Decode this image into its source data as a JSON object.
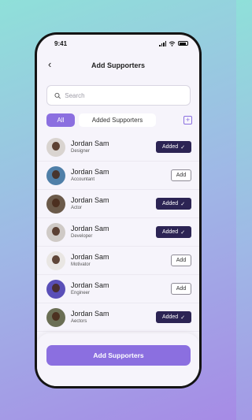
{
  "status_bar": {
    "time": "9:41"
  },
  "header": {
    "title": "Add Supporters"
  },
  "search": {
    "placeholder": "Search"
  },
  "tabs": [
    {
      "label": "All"
    },
    {
      "label": "Added Supporters"
    }
  ],
  "supporters": [
    {
      "name": "Jordan Sam",
      "role": "Designer",
      "status": "Added"
    },
    {
      "name": "Jordan Sam",
      "role": "Accountant",
      "status": "Add"
    },
    {
      "name": "Jordan Sam",
      "role": "Actor",
      "status": "Added"
    },
    {
      "name": "Jordan Sam",
      "role": "Developer",
      "status": "Added"
    },
    {
      "name": "Jordan Sam",
      "role": "Motivator",
      "status": "Add"
    },
    {
      "name": "Jordan Sam",
      "role": "Engineer",
      "status": "Add"
    },
    {
      "name": "Jordan Sam",
      "role": "Aectors",
      "status": "Added"
    }
  ],
  "cta": {
    "label": "Add Supporters"
  },
  "colors": {
    "accent": "#8b6fe0",
    "added_button": "#2c2454"
  },
  "avatar_colors": [
    "#d9d4d0",
    "#4f7fa8",
    "#6b5a4a",
    "#cfcac6",
    "#e9e6e3",
    "#5a4fb8",
    "#6b6f55"
  ]
}
